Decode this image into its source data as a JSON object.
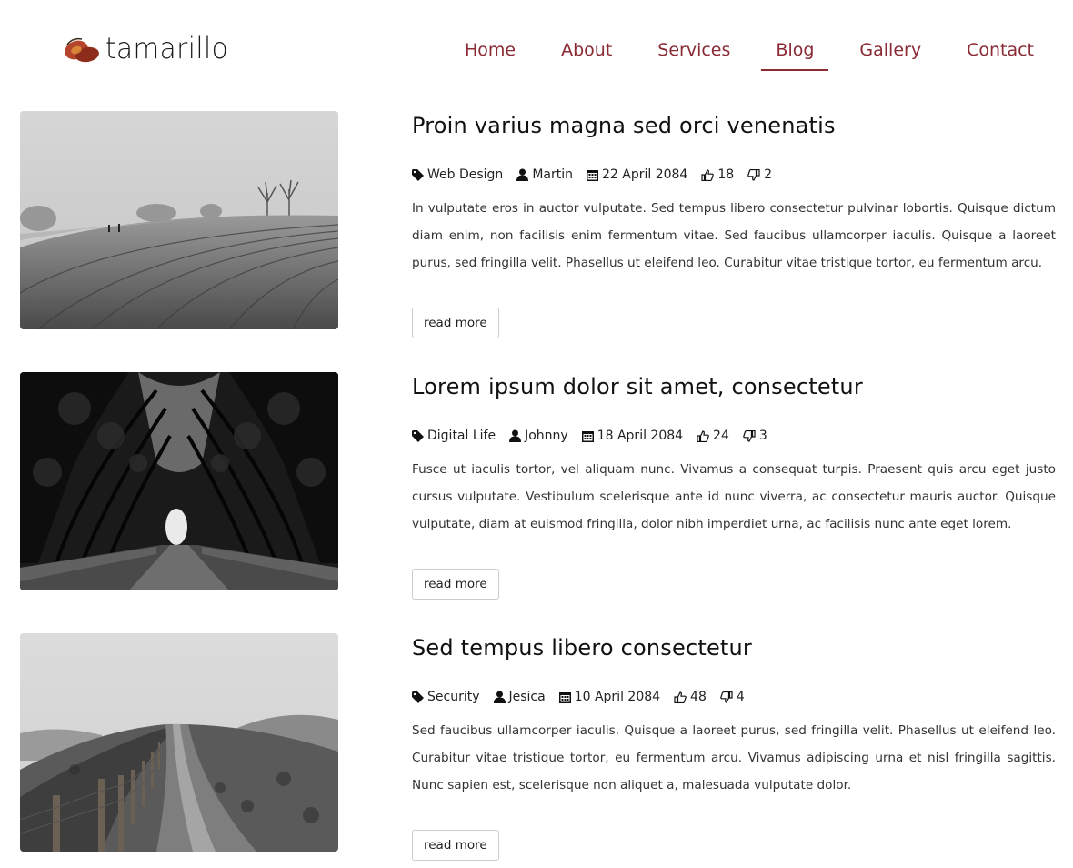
{
  "brand": {
    "name": "tamarillo",
    "accent": "#8a2a35",
    "logo_fruit": "#b5452a"
  },
  "nav": {
    "items": [
      {
        "label": "Home"
      },
      {
        "label": "About"
      },
      {
        "label": "Services"
      },
      {
        "label": "Blog",
        "active": true
      },
      {
        "label": "Gallery"
      },
      {
        "label": "Contact"
      }
    ]
  },
  "posts": [
    {
      "title": "Proin varius magna sed orci venenatis",
      "category": "Web Design",
      "author": "Martin",
      "date": "22 April 2084",
      "likes": "18",
      "dislikes": "2",
      "excerpt": "In vulputate eros in auctor vulputate. Sed tempus libero consectetur pulvinar lobortis. Quisque dictum diam enim, non facilisis enim fermentum vitae. Sed faucibus ullamcorper iaculis. Quisque a laoreet purus, sed fringilla velit. Phasellus ut eleifend leo. Curabitur vitae tristique tortor, eu fermentum arcu.",
      "button": "read more",
      "image": "misty-field-photo"
    },
    {
      "title": "Lorem ipsum dolor sit amet, consectetur",
      "category": "Digital Life",
      "author": "Johnny",
      "date": "18 April 2084",
      "likes": "24",
      "dislikes": "3",
      "excerpt": "Fusce ut iaculis tortor, vel aliquam nunc. Vivamus a consequat turpis. Praesent quis arcu eget justo cursus vulputate. Vestibulum scelerisque ante id nunc viverra, ac consectetur mauris auctor. Quisque vulputate, diam at euismod fringilla, dolor nibh imperdiet urna, ac facilisis nunc ante eget lorem.",
      "button": "read more",
      "image": "tree-tunnel-road-photo"
    },
    {
      "title": "Sed tempus libero consectetur",
      "category": "Security",
      "author": "Jesica",
      "date": "10 April 2084",
      "likes": "48",
      "dislikes": "4",
      "excerpt": "Sed faucibus ullamcorper iaculis. Quisque a laoreet purus, sed fringilla velit. Phasellus ut eleifend leo. Curabitur vitae tristique tortor, eu fermentum arcu. Vivamus adipiscing urna et nisl fringilla sagittis. Nunc sapien est, scelerisque non aliquet a, malesuada vulputate dolor.",
      "button": "read more",
      "image": "hill-path-fence-photo"
    }
  ]
}
